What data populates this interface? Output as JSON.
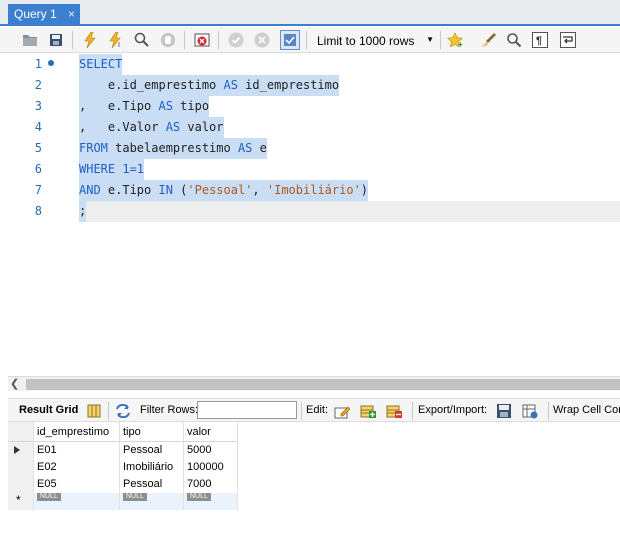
{
  "tab": {
    "title": "Query 1",
    "close": "×"
  },
  "toolbar": {
    "limit_label": "Limit to 1000 rows"
  },
  "editor": {
    "lines": [
      {
        "num": "1"
      },
      {
        "num": "2"
      },
      {
        "num": "3"
      },
      {
        "num": "4"
      },
      {
        "num": "5"
      },
      {
        "num": "6"
      },
      {
        "num": "7"
      },
      {
        "num": "8"
      }
    ],
    "tokens": {
      "l1_kw": "SELECT",
      "l2_a": "    e.id_emprestimo ",
      "l2_kw": "AS",
      "l2_b": " id_emprestimo",
      "l3_a": ",   e.Tipo ",
      "l3_kw": "AS",
      "l3_b": " tipo",
      "l4_a": ",   e.Valor ",
      "l4_kw": "AS",
      "l4_b": " valor",
      "l5_kw1": "FROM",
      "l5_a": " tabelaemprestimo ",
      "l5_kw2": "AS",
      "l5_b": " e",
      "l6_kw": "WHERE",
      "l6_num": " 1=1",
      "l7_kw1": "AND",
      "l7_a": " e.Tipo ",
      "l7_kw2": "IN",
      "l7_b": " (",
      "l7_s1": "'Pessoal'",
      "l7_c": ", ",
      "l7_s2": "'Imobiliário'",
      "l7_d": ")",
      "l8": ";"
    }
  },
  "results_toolbar": {
    "result_grid": "Result Grid",
    "filter_rows": "Filter Rows:",
    "edit": "Edit:",
    "export_import": "Export/Import:",
    "wrap_cell": "Wrap Cell Content"
  },
  "grid": {
    "columns": [
      "id_emprestimo",
      "tipo",
      "valor"
    ],
    "rows": [
      [
        "E01",
        "Pessoal",
        "5000"
      ],
      [
        "E02",
        "Imobiliário",
        "100000"
      ],
      [
        "E05",
        "Pessoal",
        "7000"
      ]
    ],
    "null_label": "NULL"
  }
}
